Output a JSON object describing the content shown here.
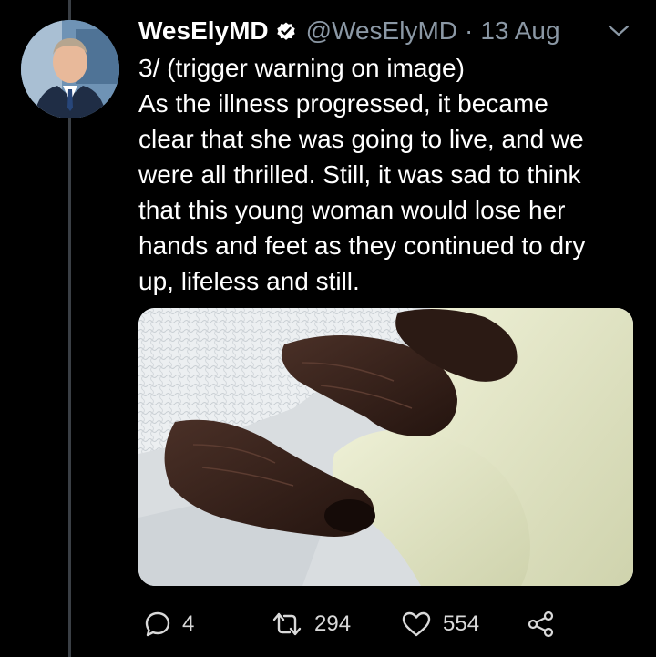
{
  "tweet": {
    "display_name": "WesElyMD",
    "verified": true,
    "handle": "@WesElyMD",
    "separator": "·",
    "date": "13 Aug",
    "text_lines": [
      "3/ (trigger warning on image)",
      "As the illness progressed, it became",
      "clear that she was going to live, and we",
      "were all thrilled. Still, it was sad to think",
      "that this young woman would lose her",
      "hands and feet as they continued to dry",
      "up, lifeless and still."
    ],
    "media_icon": "photo-of-gloved-hand-holding-dark-necrotic-fingers",
    "avatar_icon": "profile-photo-man-in-suit"
  },
  "actions": {
    "reply_count": "4",
    "retweet_count": "294",
    "like_count": "554",
    "reply_icon": "speech-bubble-icon",
    "retweet_icon": "retweet-arrows-icon",
    "like_icon": "heart-outline-icon",
    "share_icon": "share-nodes-icon"
  },
  "colors": {
    "background": "#000000",
    "text": "#ffffff",
    "secondary_text": "#8b98a5",
    "thread_line": "#3a3f45",
    "verified": "#ffffff"
  }
}
